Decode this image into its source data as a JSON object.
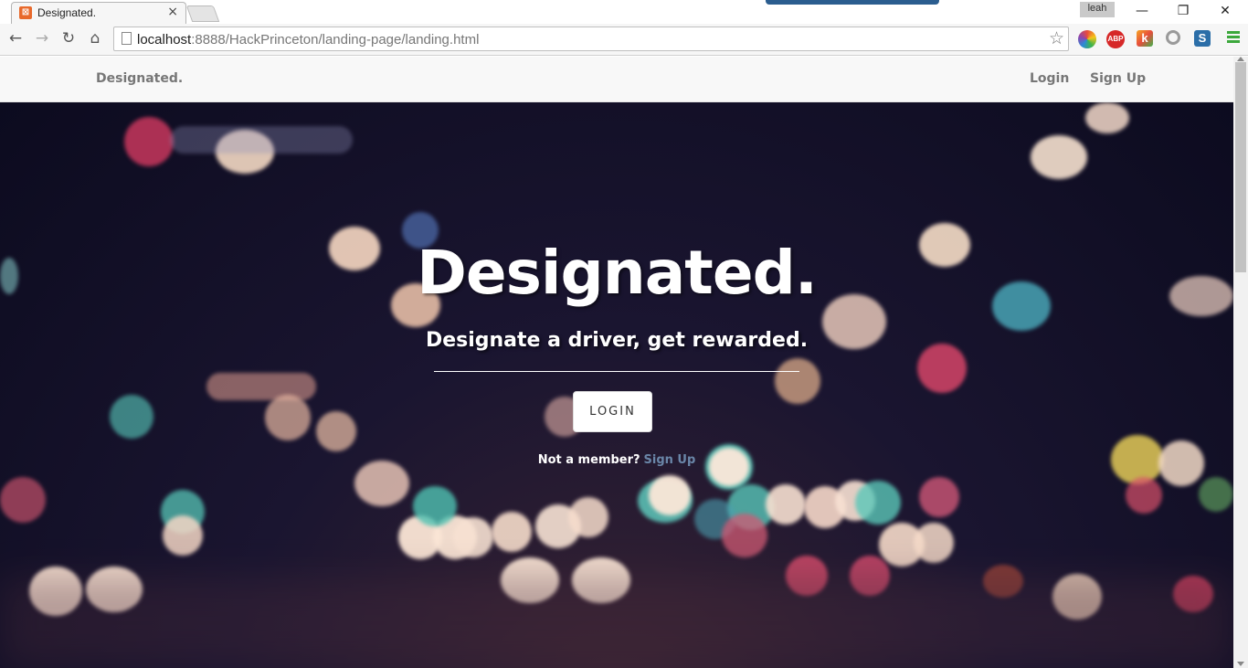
{
  "browser": {
    "tab_title": "Designated.",
    "tab_close": "×",
    "profile_name": "leah",
    "url_host": "localhost",
    "url_rest": ":8888/HackPrinceton/landing-page/landing.html",
    "back_glyph": "←",
    "forward_glyph": "→",
    "reload_glyph": "↻",
    "home_glyph": "⌂",
    "star_glyph": "☆",
    "minimize_glyph": "—",
    "restore_glyph": "❐",
    "close_glyph": "✕",
    "extensions": [
      {
        "name": "color-wheel-icon",
        "color": "#e94b3c"
      },
      {
        "name": "adblock-plus-icon",
        "color": "#d62828",
        "label": "ABP"
      },
      {
        "name": "klout-icon",
        "color": "#f5a623",
        "label": "k"
      },
      {
        "name": "location-pin-icon",
        "color": "#9a9a9a"
      },
      {
        "name": "s-extension-icon",
        "color": "#2b6ea8",
        "label": "S"
      }
    ]
  },
  "site": {
    "brand": "Designated.",
    "nav": {
      "login": "Login",
      "signup": "Sign Up"
    },
    "hero": {
      "title": "Designated.",
      "subtitle": "Designate a driver, get rewarded.",
      "login_button": "LOGIN",
      "member_prompt": "Not a member?",
      "signup_link": "Sign Up"
    }
  },
  "colors": {
    "nav_bg": "#f8f8f8",
    "nav_text": "#777777",
    "hero_dark": "#0f0e24",
    "link": "#6a86a8"
  }
}
